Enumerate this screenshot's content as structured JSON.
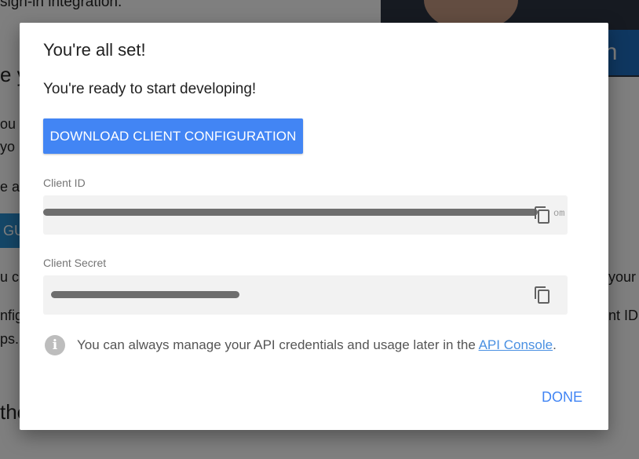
{
  "background": {
    "lines": [
      "sign-in integration.",
      "e y",
      "ou",
      "yo",
      "e a",
      "u c",
      "nfig",
      "ps.",
      "the"
    ],
    "right_lines": [
      "your",
      "nt ID"
    ],
    "button_text": "GUR",
    "video_banner": "a: In"
  },
  "dialog": {
    "title": "You're all set!",
    "subtitle": "You're ready to start developing!",
    "download_label": "DOWNLOAD CLIENT CONFIGURATION",
    "client_id": {
      "label": "Client ID",
      "value_suffix": "om",
      "copy_icon": "copy-icon"
    },
    "client_secret": {
      "label": "Client Secret",
      "copy_icon": "copy-icon"
    },
    "info": {
      "icon": "info-icon",
      "text": "You can always manage your API credentials and usage later in the ",
      "link_text": "API Console",
      "trailing": "."
    },
    "done_label": "DONE"
  },
  "colors": {
    "primary": "#4285f4",
    "link": "#4a90e2",
    "field_bg": "#f2f2f2"
  }
}
